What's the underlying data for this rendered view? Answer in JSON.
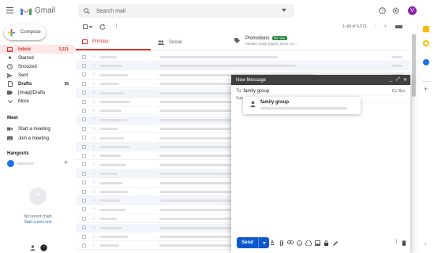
{
  "header": {
    "app_name": "Gmail",
    "search_placeholder": "Search mail",
    "avatar_letter": "V"
  },
  "sidebar": {
    "compose_label": "Compose",
    "items": [
      {
        "label": "Inbox",
        "count": "3,221"
      },
      {
        "label": "Starred",
        "count": ""
      },
      {
        "label": "Snoozed",
        "count": ""
      },
      {
        "label": "Sent",
        "count": ""
      },
      {
        "label": "Drafts",
        "count": "35"
      },
      {
        "label": "[Imap]/Drafts",
        "count": ""
      },
      {
        "label": "More",
        "count": ""
      }
    ],
    "meet_heading": "Meet",
    "meet_items": [
      "Start a meeting",
      "Join a meeting"
    ],
    "hangouts_heading": "Hangouts",
    "no_chats": "No recent chats",
    "start_new": "Start a new one"
  },
  "toolbar": {
    "pagination": "1–50 of 5,573"
  },
  "tabs": [
    {
      "label": "Primary"
    },
    {
      "label": "Social"
    },
    {
      "label": "Promotions",
      "badge": "50 new",
      "sub": "Medium Daily Digest, ISSS Acc..."
    }
  ],
  "compose_window": {
    "title": "New Message",
    "to_label": "To",
    "to_value": "family group",
    "cc_bcc": "Cc Bcc",
    "subject_label": "Sub",
    "suggestion": "family group",
    "send_label": "Send"
  },
  "colors": {
    "gmail_red": "#d93025",
    "send_blue": "#0b57d0",
    "compose_header": "#404040",
    "avatar": "#8e24aa",
    "badge_green": "#188038"
  }
}
